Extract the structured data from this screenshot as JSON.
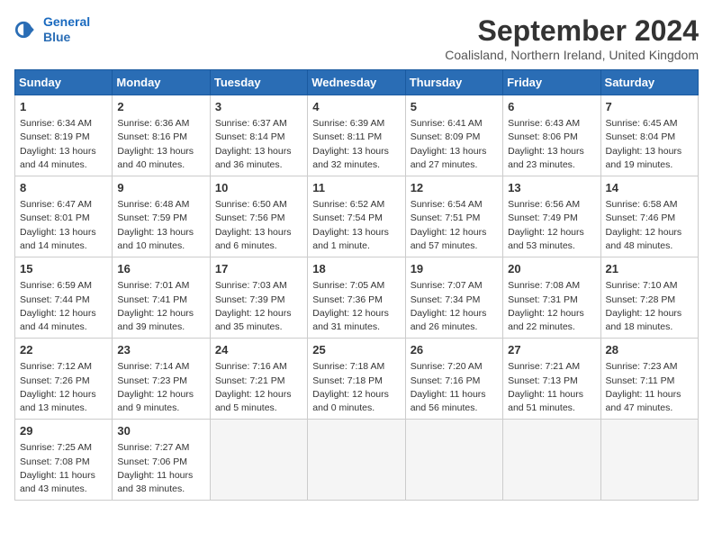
{
  "logo": {
    "line1": "General",
    "line2": "Blue"
  },
  "title": "September 2024",
  "location": "Coalisland, Northern Ireland, United Kingdom",
  "days_of_week": [
    "Sunday",
    "Monday",
    "Tuesday",
    "Wednesday",
    "Thursday",
    "Friday",
    "Saturday"
  ],
  "weeks": [
    [
      {
        "day": "1",
        "sunrise": "Sunrise: 6:34 AM",
        "sunset": "Sunset: 8:19 PM",
        "daylight": "Daylight: 13 hours and 44 minutes."
      },
      {
        "day": "2",
        "sunrise": "Sunrise: 6:36 AM",
        "sunset": "Sunset: 8:16 PM",
        "daylight": "Daylight: 13 hours and 40 minutes."
      },
      {
        "day": "3",
        "sunrise": "Sunrise: 6:37 AM",
        "sunset": "Sunset: 8:14 PM",
        "daylight": "Daylight: 13 hours and 36 minutes."
      },
      {
        "day": "4",
        "sunrise": "Sunrise: 6:39 AM",
        "sunset": "Sunset: 8:11 PM",
        "daylight": "Daylight: 13 hours and 32 minutes."
      },
      {
        "day": "5",
        "sunrise": "Sunrise: 6:41 AM",
        "sunset": "Sunset: 8:09 PM",
        "daylight": "Daylight: 13 hours and 27 minutes."
      },
      {
        "day": "6",
        "sunrise": "Sunrise: 6:43 AM",
        "sunset": "Sunset: 8:06 PM",
        "daylight": "Daylight: 13 hours and 23 minutes."
      },
      {
        "day": "7",
        "sunrise": "Sunrise: 6:45 AM",
        "sunset": "Sunset: 8:04 PM",
        "daylight": "Daylight: 13 hours and 19 minutes."
      }
    ],
    [
      {
        "day": "8",
        "sunrise": "Sunrise: 6:47 AM",
        "sunset": "Sunset: 8:01 PM",
        "daylight": "Daylight: 13 hours and 14 minutes."
      },
      {
        "day": "9",
        "sunrise": "Sunrise: 6:48 AM",
        "sunset": "Sunset: 7:59 PM",
        "daylight": "Daylight: 13 hours and 10 minutes."
      },
      {
        "day": "10",
        "sunrise": "Sunrise: 6:50 AM",
        "sunset": "Sunset: 7:56 PM",
        "daylight": "Daylight: 13 hours and 6 minutes."
      },
      {
        "day": "11",
        "sunrise": "Sunrise: 6:52 AM",
        "sunset": "Sunset: 7:54 PM",
        "daylight": "Daylight: 13 hours and 1 minute."
      },
      {
        "day": "12",
        "sunrise": "Sunrise: 6:54 AM",
        "sunset": "Sunset: 7:51 PM",
        "daylight": "Daylight: 12 hours and 57 minutes."
      },
      {
        "day": "13",
        "sunrise": "Sunrise: 6:56 AM",
        "sunset": "Sunset: 7:49 PM",
        "daylight": "Daylight: 12 hours and 53 minutes."
      },
      {
        "day": "14",
        "sunrise": "Sunrise: 6:58 AM",
        "sunset": "Sunset: 7:46 PM",
        "daylight": "Daylight: 12 hours and 48 minutes."
      }
    ],
    [
      {
        "day": "15",
        "sunrise": "Sunrise: 6:59 AM",
        "sunset": "Sunset: 7:44 PM",
        "daylight": "Daylight: 12 hours and 44 minutes."
      },
      {
        "day": "16",
        "sunrise": "Sunrise: 7:01 AM",
        "sunset": "Sunset: 7:41 PM",
        "daylight": "Daylight: 12 hours and 39 minutes."
      },
      {
        "day": "17",
        "sunrise": "Sunrise: 7:03 AM",
        "sunset": "Sunset: 7:39 PM",
        "daylight": "Daylight: 12 hours and 35 minutes."
      },
      {
        "day": "18",
        "sunrise": "Sunrise: 7:05 AM",
        "sunset": "Sunset: 7:36 PM",
        "daylight": "Daylight: 12 hours and 31 minutes."
      },
      {
        "day": "19",
        "sunrise": "Sunrise: 7:07 AM",
        "sunset": "Sunset: 7:34 PM",
        "daylight": "Daylight: 12 hours and 26 minutes."
      },
      {
        "day": "20",
        "sunrise": "Sunrise: 7:08 AM",
        "sunset": "Sunset: 7:31 PM",
        "daylight": "Daylight: 12 hours and 22 minutes."
      },
      {
        "day": "21",
        "sunrise": "Sunrise: 7:10 AM",
        "sunset": "Sunset: 7:28 PM",
        "daylight": "Daylight: 12 hours and 18 minutes."
      }
    ],
    [
      {
        "day": "22",
        "sunrise": "Sunrise: 7:12 AM",
        "sunset": "Sunset: 7:26 PM",
        "daylight": "Daylight: 12 hours and 13 minutes."
      },
      {
        "day": "23",
        "sunrise": "Sunrise: 7:14 AM",
        "sunset": "Sunset: 7:23 PM",
        "daylight": "Daylight: 12 hours and 9 minutes."
      },
      {
        "day": "24",
        "sunrise": "Sunrise: 7:16 AM",
        "sunset": "Sunset: 7:21 PM",
        "daylight": "Daylight: 12 hours and 5 minutes."
      },
      {
        "day": "25",
        "sunrise": "Sunrise: 7:18 AM",
        "sunset": "Sunset: 7:18 PM",
        "daylight": "Daylight: 12 hours and 0 minutes."
      },
      {
        "day": "26",
        "sunrise": "Sunrise: 7:20 AM",
        "sunset": "Sunset: 7:16 PM",
        "daylight": "Daylight: 11 hours and 56 minutes."
      },
      {
        "day": "27",
        "sunrise": "Sunrise: 7:21 AM",
        "sunset": "Sunset: 7:13 PM",
        "daylight": "Daylight: 11 hours and 51 minutes."
      },
      {
        "day": "28",
        "sunrise": "Sunrise: 7:23 AM",
        "sunset": "Sunset: 7:11 PM",
        "daylight": "Daylight: 11 hours and 47 minutes."
      }
    ],
    [
      {
        "day": "29",
        "sunrise": "Sunrise: 7:25 AM",
        "sunset": "Sunset: 7:08 PM",
        "daylight": "Daylight: 11 hours and 43 minutes."
      },
      {
        "day": "30",
        "sunrise": "Sunrise: 7:27 AM",
        "sunset": "Sunset: 7:06 PM",
        "daylight": "Daylight: 11 hours and 38 minutes."
      },
      null,
      null,
      null,
      null,
      null
    ]
  ]
}
